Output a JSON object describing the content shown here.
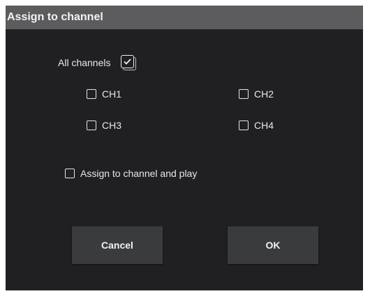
{
  "dialog": {
    "title": "Assign to channel"
  },
  "all_channels": {
    "label": "All channels",
    "checked": true
  },
  "channels": [
    {
      "label": "CH1",
      "checked": false
    },
    {
      "label": "CH2",
      "checked": false
    },
    {
      "label": "CH3",
      "checked": false
    },
    {
      "label": "CH4",
      "checked": false
    }
  ],
  "assign_and_play": {
    "label": "Assign to channel and play",
    "checked": false
  },
  "buttons": {
    "cancel_label": "Cancel",
    "ok_label": "OK"
  },
  "colors": {
    "dialog_background": "#202022",
    "titlebar_background": "#5c5c5e",
    "button_background": "#3a3b3d",
    "text": "#e8e8e8"
  }
}
